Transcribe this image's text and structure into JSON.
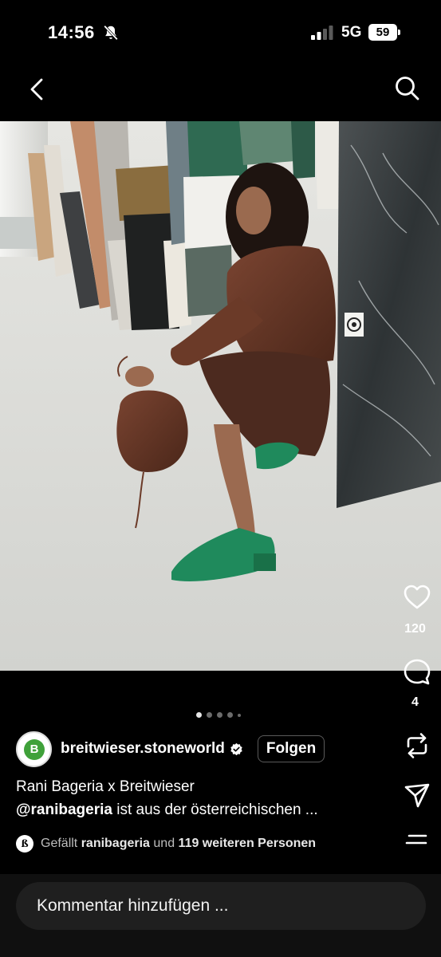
{
  "status_bar": {
    "time": "14:56",
    "network": "5G",
    "battery": "59",
    "bell_icon": "bell-muted-icon",
    "signal_icon": "signal-bars-icon"
  },
  "nav": {
    "back_icon": "chevron-left-icon",
    "search_icon": "search-icon"
  },
  "post": {
    "username": "breitwieser.stoneworld",
    "avatar_letter": "B",
    "follow_label": "Folgen",
    "carousel": {
      "count": 5,
      "active": 0
    },
    "likes_count": "120",
    "comments_count": "4",
    "caption_line1": "Rani Bageria x Breitwieser",
    "caption_mention": "@ranibageria",
    "caption_rest": " ist aus der österreichischen ...",
    "likes_prefix": "Gefällt ",
    "likes_user": "ranibageria",
    "likes_mid": " und ",
    "likes_others": "119 weiteren Personen",
    "likes_avatar_letter": "ß"
  },
  "comment": {
    "placeholder": "Kommentar hinzufügen ..."
  },
  "colors": {
    "background": "#000000",
    "avatar_green": "#3fa13a",
    "shoe_green": "#1f8a5c",
    "leather_brown": "#5e3222"
  }
}
